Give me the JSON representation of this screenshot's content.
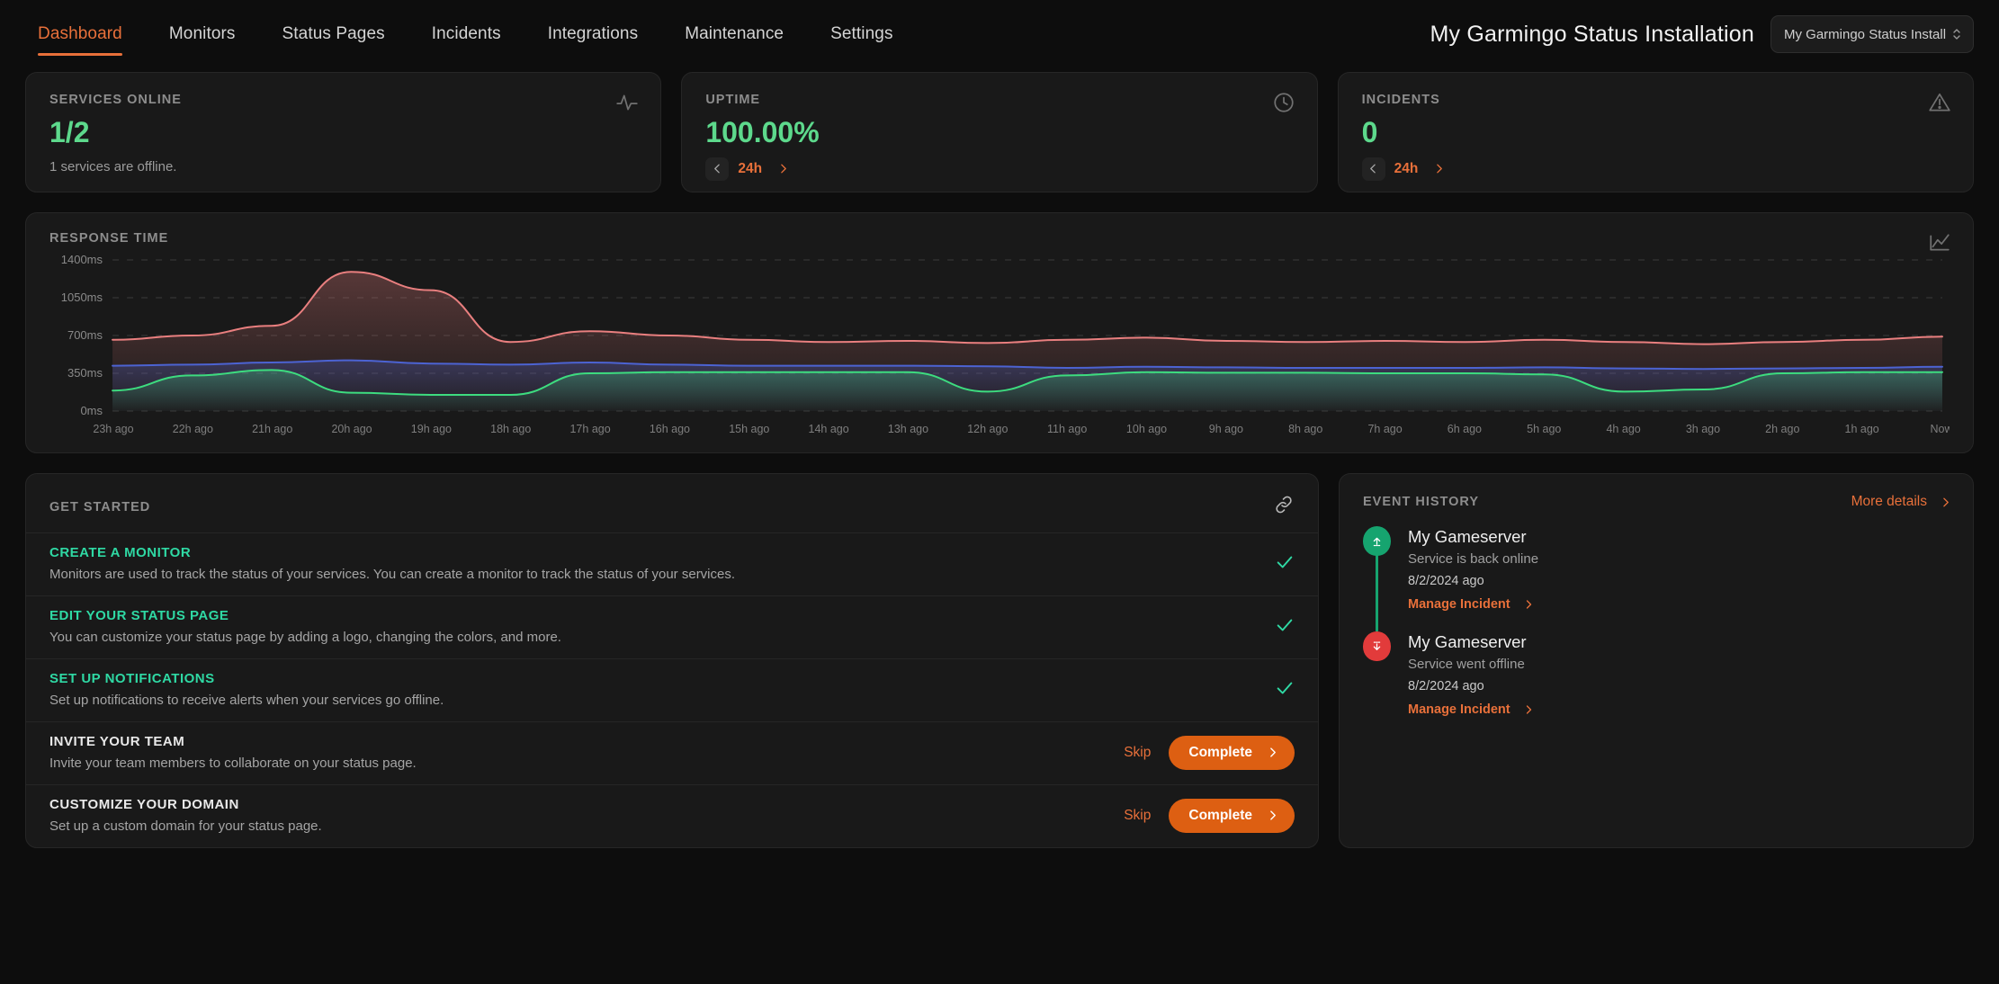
{
  "nav": {
    "items": [
      {
        "label": "Dashboard",
        "active": true
      },
      {
        "label": "Monitors",
        "active": false
      },
      {
        "label": "Status Pages",
        "active": false
      },
      {
        "label": "Incidents",
        "active": false
      },
      {
        "label": "Integrations",
        "active": false
      },
      {
        "label": "Maintenance",
        "active": false
      },
      {
        "label": "Settings",
        "active": false
      }
    ],
    "installation_title": "My Garmingo Status Installation",
    "installation_select_value": "My Garmingo Status Install"
  },
  "stats": {
    "services": {
      "label": "SERVICES ONLINE",
      "value": "1/2",
      "sub": "1 services are offline.",
      "icon": "activity-icon"
    },
    "uptime": {
      "label": "UPTIME",
      "value": "100.00%",
      "range": "24h",
      "icon": "clock-icon"
    },
    "incidents": {
      "label": "INCIDENTS",
      "value": "0",
      "range": "24h",
      "icon": "warning-icon"
    }
  },
  "chart_data": {
    "type": "line",
    "title": "RESPONSE TIME",
    "xlabel": "",
    "ylabel": "",
    "ylim": [
      0,
      1400
    ],
    "yticks": [
      0,
      350,
      700,
      1050,
      1400
    ],
    "ytick_labels": [
      "0ms",
      "350ms",
      "700ms",
      "1050ms",
      "1400ms"
    ],
    "grid": true,
    "legend": "none",
    "categories": [
      "23h ago",
      "22h ago",
      "21h ago",
      "20h ago",
      "19h ago",
      "18h ago",
      "17h ago",
      "16h ago",
      "15h ago",
      "14h ago",
      "13h ago",
      "12h ago",
      "11h ago",
      "10h ago",
      "9h ago",
      "8h ago",
      "7h ago",
      "6h ago",
      "5h ago",
      "4h ago",
      "3h ago",
      "2h ago",
      "1h ago",
      "Now"
    ],
    "series": [
      {
        "name": "monitor-red",
        "color": "#e97f7f",
        "values": [
          660,
          700,
          790,
          1290,
          1120,
          640,
          740,
          700,
          660,
          640,
          650,
          630,
          660,
          680,
          650,
          640,
          650,
          640,
          660,
          640,
          620,
          640,
          660,
          690
        ]
      },
      {
        "name": "monitor-blue",
        "color": "#4c63d2",
        "values": [
          420,
          430,
          450,
          470,
          440,
          430,
          450,
          430,
          420,
          420,
          420,
          415,
          400,
          410,
          405,
          400,
          400,
          400,
          405,
          395,
          390,
          395,
          400,
          410
        ]
      },
      {
        "name": "monitor-green",
        "color": "#3ddc7f",
        "values": [
          190,
          330,
          380,
          170,
          150,
          150,
          350,
          360,
          360,
          360,
          360,
          180,
          330,
          360,
          355,
          355,
          350,
          350,
          340,
          180,
          200,
          350,
          360,
          360
        ]
      }
    ]
  },
  "get_started": {
    "title": "GET STARTED",
    "icon": "link-icon",
    "items": [
      {
        "title": "CREATE A MONITOR",
        "desc": "Monitors are used to track the status of your services. You can create a monitor to track the status of your services.",
        "done": true
      },
      {
        "title": "EDIT YOUR STATUS PAGE",
        "desc": "You can customize your status page by adding a logo, changing the colors, and more.",
        "done": true
      },
      {
        "title": "SET UP NOTIFICATIONS",
        "desc": "Set up notifications to receive alerts when your services go offline.",
        "done": true
      },
      {
        "title": "INVITE YOUR TEAM",
        "desc": "Invite your team members to collaborate on your status page.",
        "done": false,
        "skip_label": "Skip",
        "complete_label": "Complete"
      },
      {
        "title": "CUSTOMIZE YOUR DOMAIN",
        "desc": "Set up a custom domain for your status page.",
        "done": false,
        "skip_label": "Skip",
        "complete_label": "Complete"
      }
    ]
  },
  "event_history": {
    "title": "EVENT HISTORY",
    "more_label": "More details",
    "events": [
      {
        "name": "My Gameserver",
        "state": "Service is back online",
        "time": "8/2/2024 ago",
        "link": "Manage Incident",
        "kind": "up"
      },
      {
        "name": "My Gameserver",
        "state": "Service went offline",
        "time": "8/2/2024 ago",
        "link": "Manage Incident",
        "kind": "down"
      }
    ]
  },
  "colors": {
    "accent": "#e8703a",
    "accent_button": "#dd5f12",
    "success": "#2fd9a4",
    "green_value": "#5dd98c",
    "danger": "#e23b3b",
    "background": "#0d0d0d",
    "card": "#191919"
  }
}
